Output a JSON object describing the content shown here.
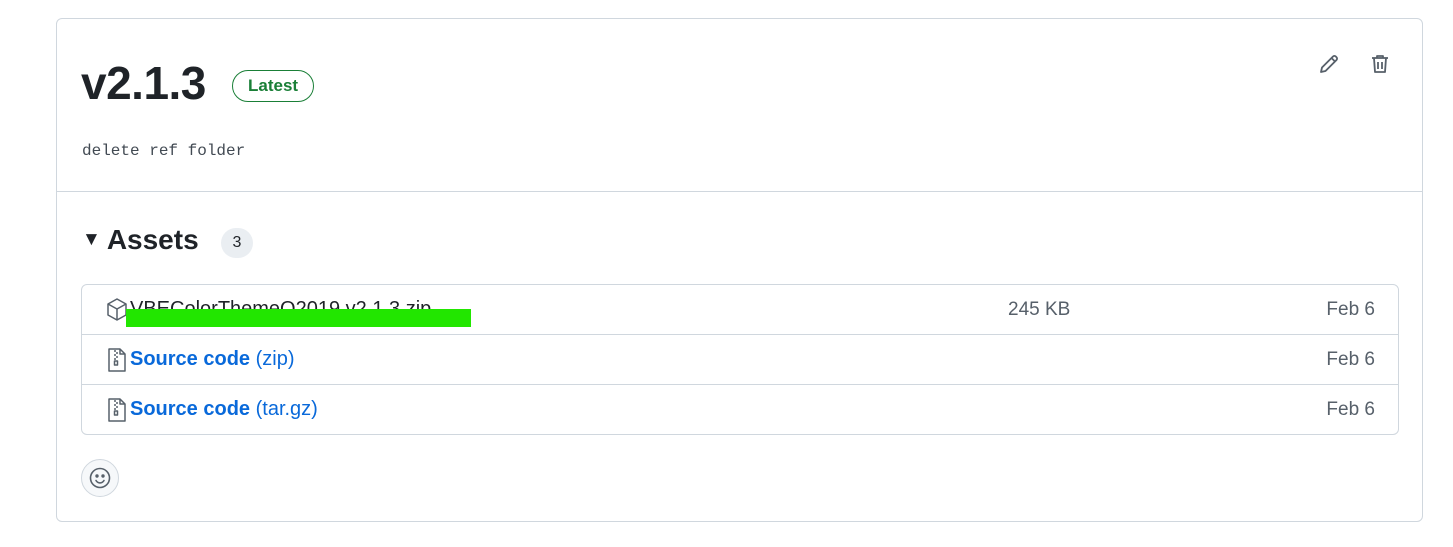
{
  "release": {
    "title": "v2.1.3",
    "badge": "Latest",
    "description": "delete ref folder",
    "actions": {
      "edit_icon": "pencil-icon",
      "delete_icon": "trash-icon"
    }
  },
  "assets": {
    "toggle_icon": "triangle-down-icon",
    "title": "Assets",
    "count": "3",
    "items": [
      {
        "icon": "package-icon",
        "name": "VBEColorThemeO2019.v2.1.3.zip",
        "suffix": "",
        "size": "245 KB",
        "date": "Feb 6"
      },
      {
        "icon": "file-zip-icon",
        "name": "Source code",
        "suffix": " (zip)",
        "size": "",
        "date": "Feb 6"
      },
      {
        "icon": "file-zip-icon",
        "name": "Source code",
        "suffix": " (tar.gz)",
        "size": "",
        "date": "Feb 6"
      }
    ]
  },
  "reactions": {
    "icon": "smiley-icon"
  },
  "colors": {
    "accent": "#0969da",
    "latest": "#1a7f37",
    "border": "#d0d7de",
    "highlight": "#22e600"
  }
}
